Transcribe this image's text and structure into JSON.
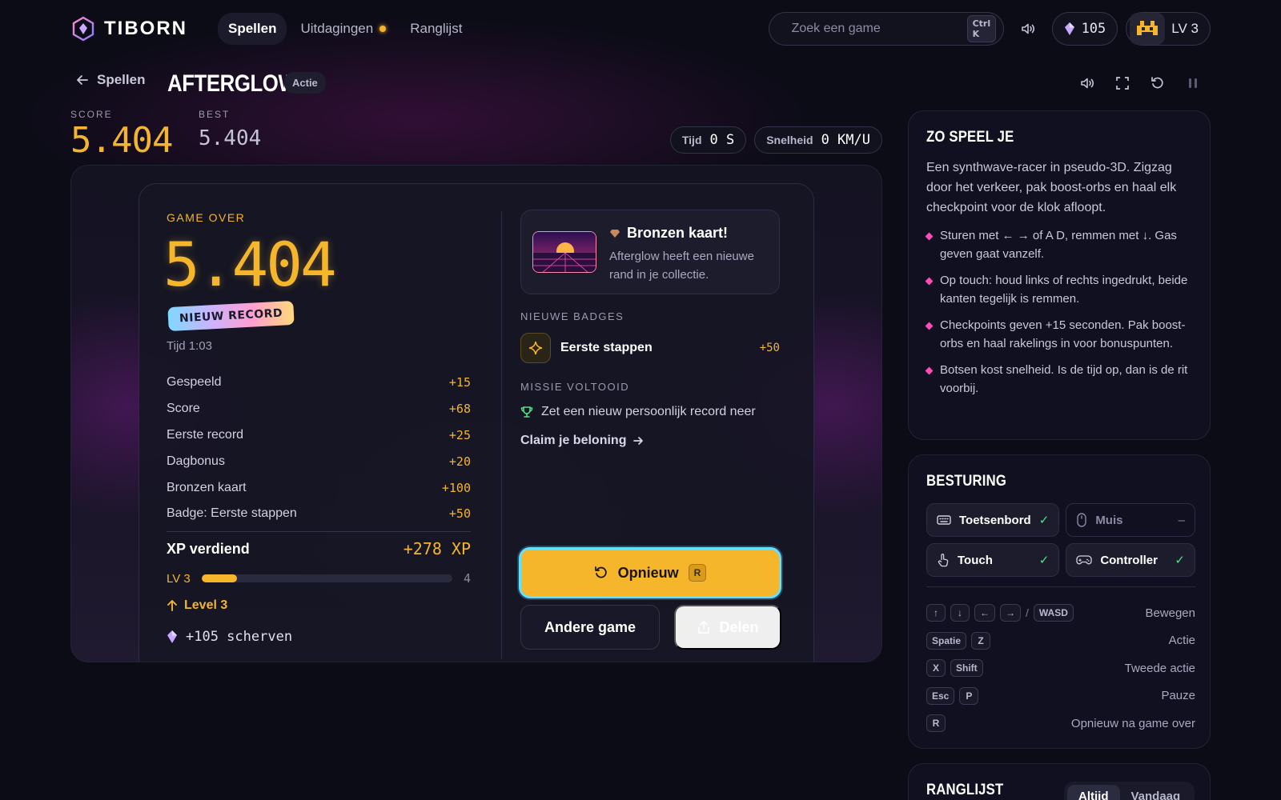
{
  "app": {
    "name": "TIBORN"
  },
  "nav": {
    "links": [
      {
        "label": "Spellen",
        "active": true
      },
      {
        "label": "Uitdagingen",
        "active": false,
        "has_dot": true
      },
      {
        "label": "Ranglijst",
        "active": false
      }
    ],
    "search": {
      "placeholder": "Zoek een game",
      "shortcut": "Ctrl K",
      "icon": "search-icon"
    },
    "shards": "105",
    "level": "LV 3"
  },
  "game": {
    "back_label": "Spellen",
    "title": "AFTERGLOW",
    "genre": "Actie",
    "score_label": "SCORE",
    "score": "5.404",
    "best_label": "BEST",
    "best": "5.404",
    "time_label": "Tijd",
    "time_value": "0 S",
    "speed_label": "Snelheid",
    "speed_value": "0 KM/U"
  },
  "game_over": {
    "label": "GAME OVER",
    "score": "5.404",
    "record_badge": "NIEUW RECORD",
    "time": "Tijd 1:03",
    "rewards": [
      {
        "label": "Gespeeld",
        "value": "+15"
      },
      {
        "label": "Score",
        "value": "+68"
      },
      {
        "label": "Eerste record",
        "value": "+25"
      },
      {
        "label": "Dagbonus",
        "value": "+20"
      },
      {
        "label": "Bronzen kaart",
        "value": "+100"
      },
      {
        "label": "Badge: Eerste stappen",
        "value": "+50"
      }
    ],
    "xp_label": "XP verdiend",
    "xp_value": "+278 XP",
    "level_from": "LV 3",
    "level_to": "4",
    "level_progress": 0.14,
    "level_up": "Level 3",
    "shards": "+105 scherven"
  },
  "unlock": {
    "title": "Bronzen kaart!",
    "description": "Afterglow heeft een nieuwe rand in je collectie."
  },
  "badges": {
    "label": "NIEUWE BADGES",
    "items": [
      {
        "name": "Eerste stappen",
        "value": "+50"
      }
    ]
  },
  "mission": {
    "label": "MISSIE VOLTOOID",
    "text": "Zet een nieuw persoonlijk record neer",
    "claim": "Claim je beloning"
  },
  "actions": {
    "retry": "Opnieuw",
    "retry_key": "R",
    "other_game": "Andere game",
    "share": "Delen"
  },
  "howto": {
    "title": "ZO SPEEL JE",
    "intro": "Een synthwave-racer in pseudo-3D. Zigzag door het verkeer, pak boost-orbs en haal elk checkpoint voor de klok afloopt.",
    "tips": [
      "Sturen met ← → of A D, remmen met ↓. Gas geven gaat vanzelf.",
      "Op touch: houd links of rechts ingedrukt, beide kanten tegelijk is remmen.",
      "Checkpoints geven +15 seconden. Pak boost-orbs en haal rakelings in voor bonuspunten.",
      "Botsen kost snelheid. Is de tijd op, dan is de rit voorbij."
    ]
  },
  "controls": {
    "title": "BESTURING",
    "devices": [
      {
        "label": "Toetsenbord",
        "status": "✓",
        "on": true,
        "icon": "keyboard-icon"
      },
      {
        "label": "Muis",
        "status": "–",
        "on": false,
        "icon": "mouse-icon"
      },
      {
        "label": "Touch",
        "status": "✓",
        "on": true,
        "icon": "touch-icon"
      },
      {
        "label": "Controller",
        "status": "✓",
        "on": true,
        "icon": "gamepad-icon"
      }
    ],
    "keys": [
      {
        "keys": [
          "↑",
          "↓",
          "←",
          "→"
        ],
        "alt": "WASD",
        "action": "Bewegen"
      },
      {
        "keys": [
          "Spatie",
          "Z"
        ],
        "action": "Actie"
      },
      {
        "keys": [
          "X",
          "Shift"
        ],
        "action": "Tweede actie"
      },
      {
        "keys": [
          "Esc",
          "P"
        ],
        "action": "Pauze"
      },
      {
        "keys": [
          "R"
        ],
        "action": "Opnieuw na game over"
      }
    ]
  },
  "leaderboard": {
    "title": "RANGLIJST",
    "tabs": [
      {
        "label": "Altijd",
        "active": true
      },
      {
        "label": "Vandaag",
        "active": false
      }
    ]
  },
  "colors": {
    "accent": "#f5b62b",
    "focus_ring": "#64e0ff",
    "bullet": "#ff4db8",
    "check": "#55e08a",
    "background": "#0c0c17"
  }
}
